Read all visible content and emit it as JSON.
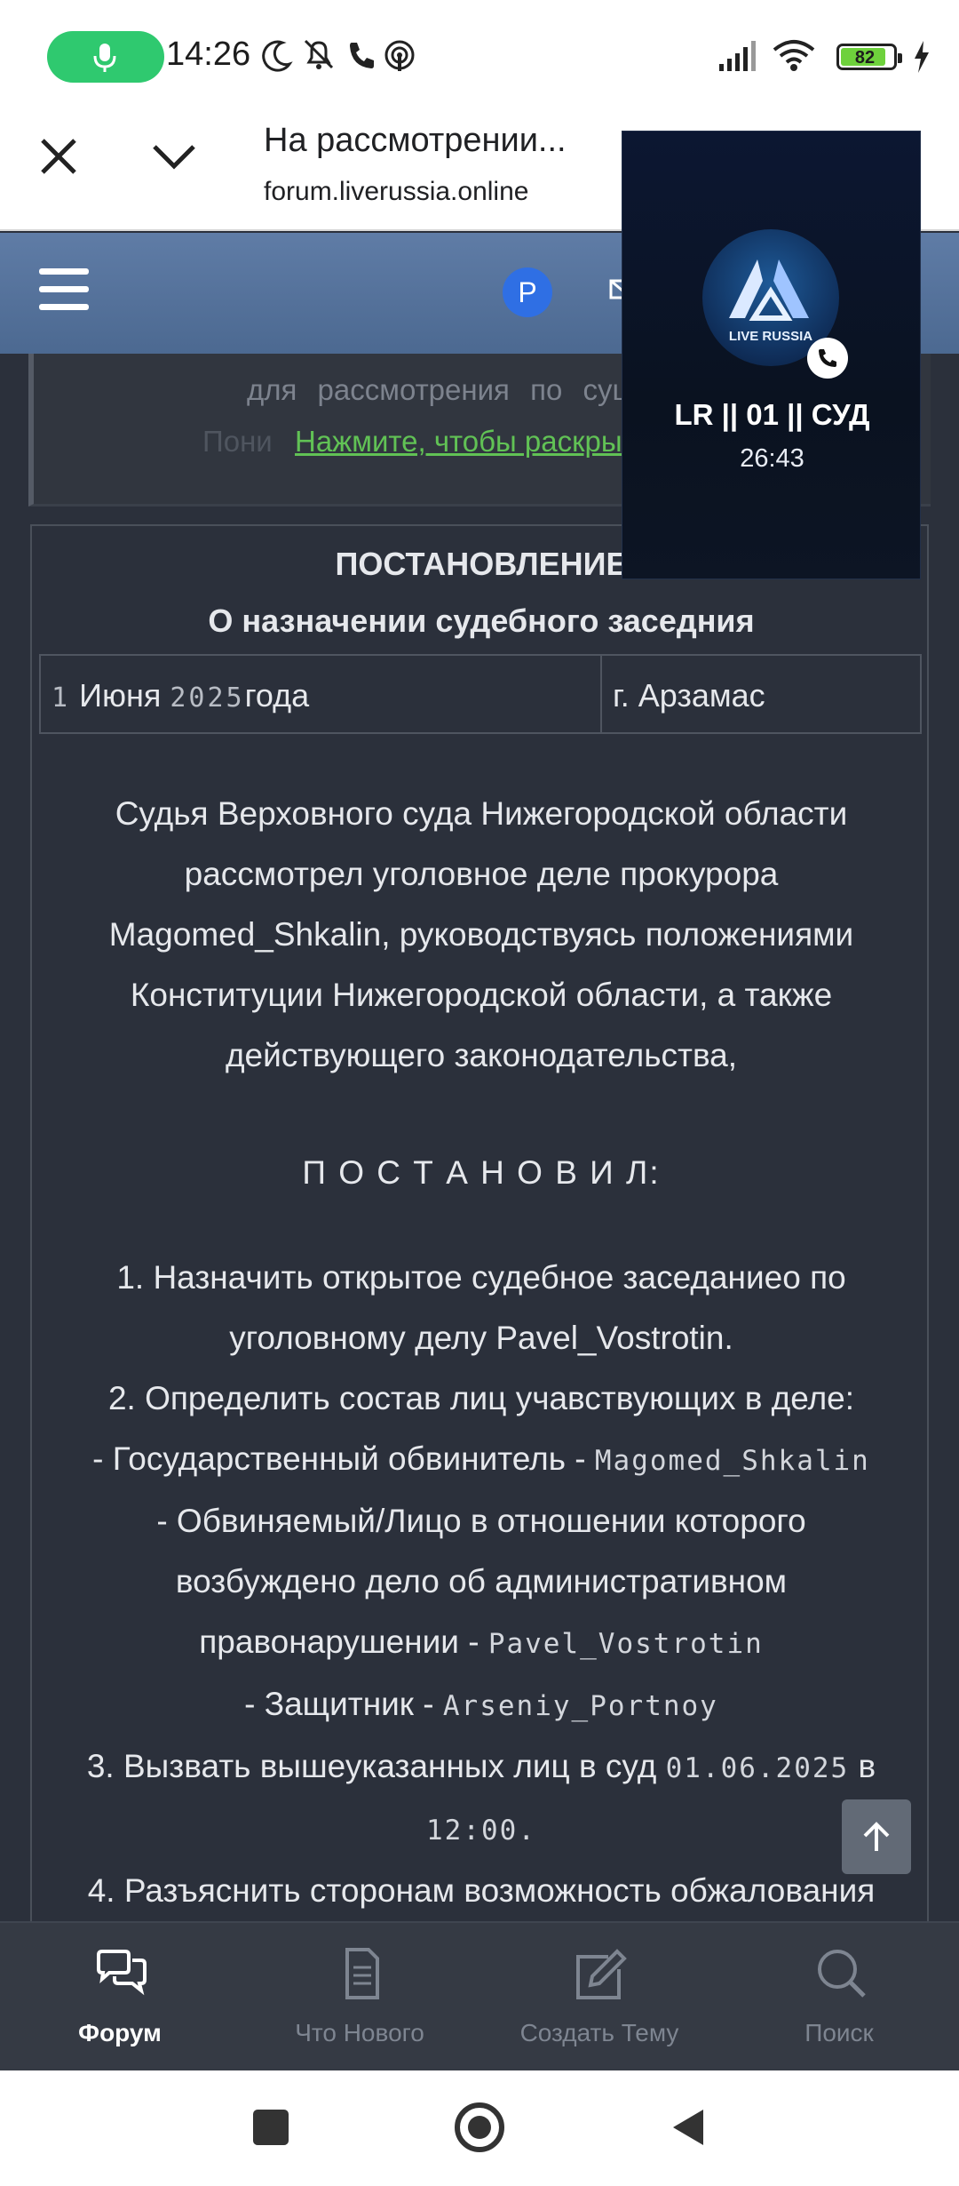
{
  "status_bar": {
    "time": "14:26",
    "battery": "82"
  },
  "browser": {
    "title": "На рассмотрении...",
    "url": "forum.liverussia.online"
  },
  "forum_header": {
    "avatar_letter": "P"
  },
  "spoiler": {
    "faded_text": "для рассмотрения по сущ",
    "faded_text2": "Пони",
    "expand_link": "Нажмите, чтобы раскры"
  },
  "document": {
    "title": "ПОСТАНОВЛЕНИЕ",
    "subtitle": "О назначении судебного заседния",
    "date_day": "1",
    "date_month": "Июня",
    "date_year": "2025",
    "date_suffix": "года",
    "city": "г. Арзамас",
    "intro": [
      "Судья Верховного суда Нижегородской области",
      "рассмотрел уголовное деле прокурора",
      "Magomed_Shkalin, руководствуясь положениями",
      "Конституции Нижегородской области, а также",
      "действующего законодательства,"
    ],
    "decree_heading": "П О С Т А Н О В И Л:",
    "item1_line1": "1. Назначить открытое судебное заседаниео по",
    "item1_line2": "уголовному делу Pavel_Vostrotin.",
    "item2": "2. Определить состав лиц учавствующих в деле:",
    "prosecutor_label": "- Государственный обвинитель -",
    "prosecutor_name": "Magomed_Shkalin",
    "accused_line1": "- Обвиняемый/Лицо в отношении которого",
    "accused_line2": "возбуждено дело об административном",
    "accused_line3": "правонарушении -",
    "accused_name": "Pavel_Vostrotin",
    "defender_label": "- Защитник -",
    "defender_name": "Arseniy_Portnoy",
    "item3_label": "3. Вызвать вышеуказанных лиц в суд",
    "item3_date": "01.06.2025",
    "item3_in": "в",
    "item3_time": "12:00.",
    "item4_partial": "4. Разъяснить сторонам возможность обжалования"
  },
  "tabs": [
    {
      "label": "Форум",
      "icon": "chat-bubbles-icon",
      "active": true
    },
    {
      "label": "Что Нового",
      "icon": "document-icon",
      "active": false
    },
    {
      "label": "Создать Тему",
      "icon": "edit-icon",
      "active": false
    },
    {
      "label": "Поиск",
      "icon": "search-icon",
      "active": false
    }
  ],
  "call_overlay": {
    "logo_text": "LIVE RUSSIA",
    "name": "LR || 01 || СУД",
    "timer": "26:43"
  },
  "colors": {
    "link_green": "#61c255",
    "header_blue": "#5f7ca6",
    "mic_green": "#2fc96f",
    "avatar_blue": "#2f6fe4"
  }
}
